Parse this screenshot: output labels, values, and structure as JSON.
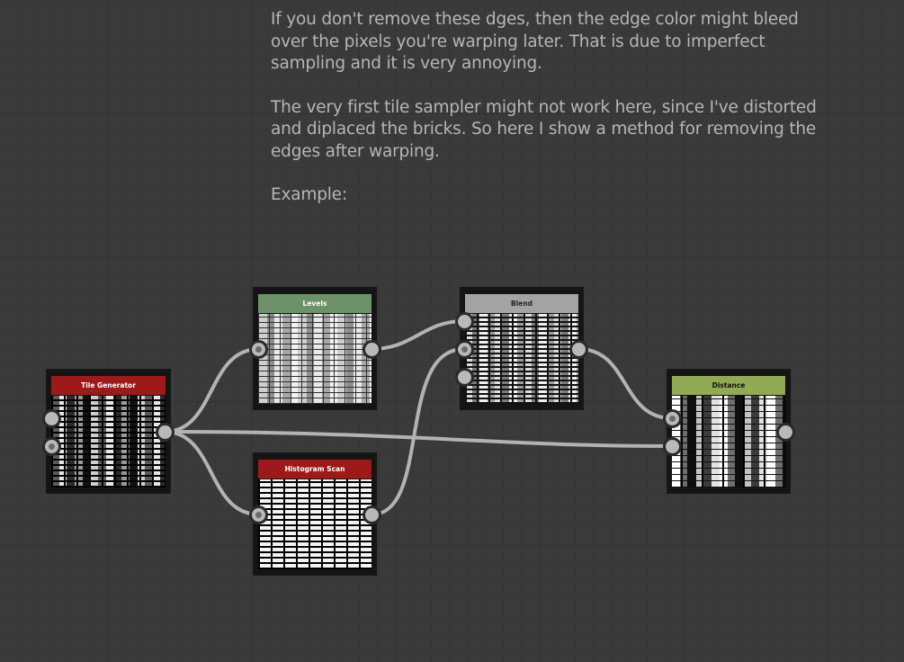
{
  "comment": {
    "paragraph_1": "If you don't remove these dges, then the edge color might bleed\nover the pixels you're warping later. That is due to imperfect\nsampling and it is very annoying.",
    "paragraph_2": "The very first tile sampler might not work here, since I've distorted\nand diplaced the bricks. So here I show a method for removing the\nedges after warping.",
    "paragraph_3": "Example:"
  },
  "nodes": {
    "tile_generator": {
      "title": "Tile Generator",
      "header_color": "#9c1a1a"
    },
    "levels": {
      "title": "Levels",
      "header_color": "#6d9168"
    },
    "blend": {
      "title": "Blend",
      "header_color": "#a3a3a3"
    },
    "histogram_scan": {
      "title": "Histogram Scan",
      "header_color": "#9c1a1a"
    },
    "distance": {
      "title": "Distance",
      "header_color": "#92aa55"
    }
  },
  "colors": {
    "background": "#3a3a3a",
    "wire": "#b3b3b3",
    "pin": "#b9b9b9",
    "comment_text": "#b6b6b6"
  }
}
